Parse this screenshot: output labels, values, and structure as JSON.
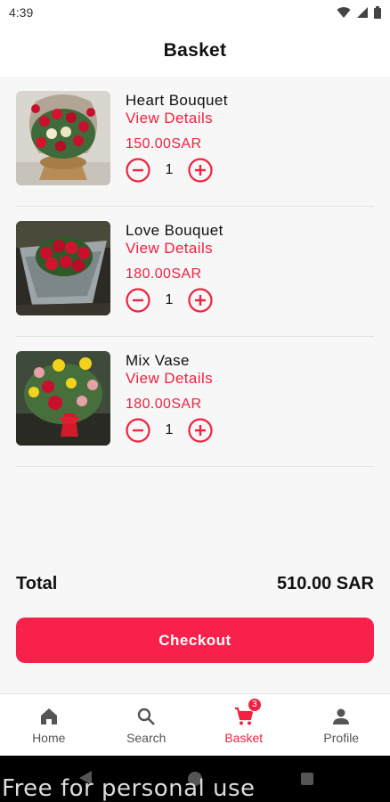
{
  "status_bar": {
    "time": "4:39"
  },
  "header": {
    "title": "Basket"
  },
  "items": [
    {
      "name": "Heart Bouquet",
      "details_label": "View Details",
      "price": "150.00SAR",
      "quantity": "1"
    },
    {
      "name": "Love Bouquet",
      "details_label": "View Details",
      "price": "180.00SAR",
      "quantity": "1"
    },
    {
      "name": "Mix Vase",
      "details_label": "View Details",
      "price": "180.00SAR",
      "quantity": "1"
    }
  ],
  "summary": {
    "total_label": "Total",
    "total_value": "510.00 SAR"
  },
  "checkout": {
    "label": "Checkout"
  },
  "nav": {
    "home": "Home",
    "search": "Search",
    "basket": "Basket",
    "basket_badge": "3",
    "profile": "Profile"
  },
  "watermark": "Free for personal use",
  "colors": {
    "accent": "#f0223f",
    "checkout": "#f7214b"
  }
}
